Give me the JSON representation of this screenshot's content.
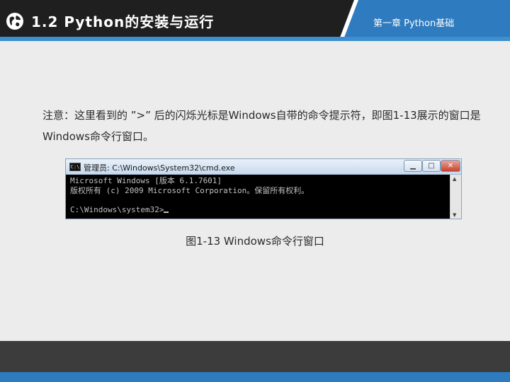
{
  "header": {
    "section_title": "1.2  Python的安装与运行",
    "chapter_label": "第一章 Python基础",
    "icon": "globe-icon"
  },
  "note": {
    "text": "注意：这里看到的 ”>” 后的闪烁光标是Windows自带的命令提示符，即图1-13展示的窗口是Windows命令行窗口。"
  },
  "cmd_window": {
    "title": "管理员: C:\\Windows\\System32\\cmd.exe",
    "app_icon_text": "C:\\",
    "buttons": {
      "minimize": "▁",
      "maximize": "□",
      "close": "✕"
    },
    "lines": [
      "Microsoft Windows [版本 6.1.7601]",
      "版权所有 (c) 2009 Microsoft Corporation。保留所有权利。",
      "",
      "C:\\Windows\\system32>"
    ]
  },
  "caption": "图1-13  Windows命令行窗口",
  "colors": {
    "header_blue": "#2e7bbf",
    "header_dark": "#1f1f1f",
    "background": "#ececec",
    "footer_dark": "#3c3c3c"
  }
}
